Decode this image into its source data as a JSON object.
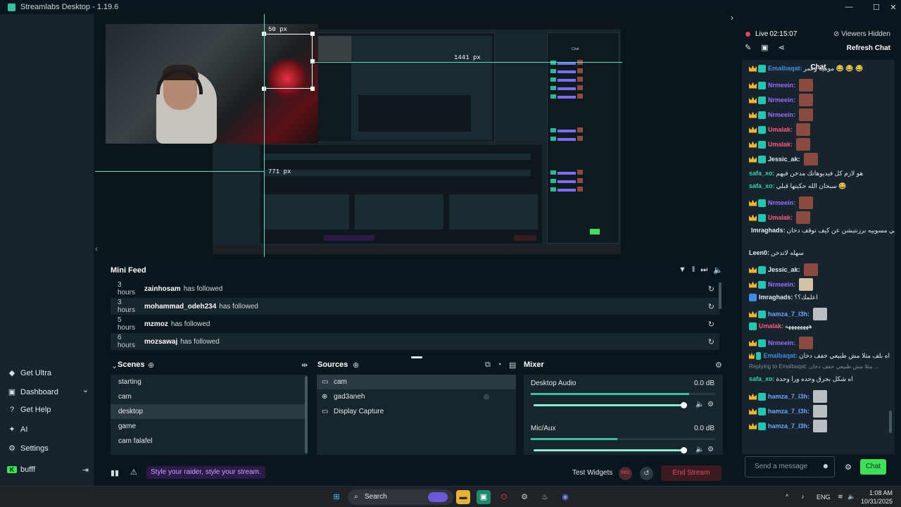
{
  "window": {
    "title": "Streamlabs Desktop - 1.19.6",
    "minimize": "—",
    "maximize": "☐",
    "close": "✕"
  },
  "sidebar": {
    "items": [
      {
        "icon": "diamond-icon",
        "glyph": "◆",
        "label": "Get Ultra"
      },
      {
        "icon": "dashboard-icon",
        "glyph": "▣",
        "label": "Dashboard",
        "chevron": "⌄"
      },
      {
        "icon": "help-icon",
        "glyph": "?",
        "label": "Get Help"
      },
      {
        "icon": "ai-icon",
        "glyph": "✦",
        "label": "AI"
      },
      {
        "icon": "settings-icon",
        "glyph": "⚙",
        "label": "Settings"
      }
    ],
    "user": {
      "name": "bufff",
      "logout": "⇥"
    }
  },
  "preview": {
    "label_top": "50 px",
    "label_right": "1441 px",
    "label_left": "771 px"
  },
  "mini_feed": {
    "title": "Mini Feed",
    "rows": [
      {
        "time": "3 hours",
        "user": "zainhosam",
        "action": "has followed"
      },
      {
        "time": "3 hours",
        "user": "mohammad_odeh234",
        "action": "has followed"
      },
      {
        "time": "5 hours",
        "user": "mzmoz",
        "action": "has followed"
      },
      {
        "time": "6 hours",
        "user": "mozsawaj",
        "action": "has followed"
      }
    ]
  },
  "scenes": {
    "title": "Scenes",
    "items": [
      "starting",
      "cam",
      "desktop",
      "game",
      "cam falafel"
    ],
    "selected": "desktop"
  },
  "sources": {
    "title": "Sources",
    "items": [
      {
        "icon": "camera-icon",
        "glyph": "▭",
        "label": "cam"
      },
      {
        "icon": "globe-icon",
        "glyph": "⊕",
        "label": "gad3aneh"
      },
      {
        "icon": "monitor-icon",
        "glyph": "▭",
        "label": "Display Capture"
      }
    ]
  },
  "mixer": {
    "title": "Mixer",
    "channels": [
      {
        "name": "Desktop Audio",
        "db": "0.0 dB",
        "meter": 0.86,
        "volume": 1.0
      },
      {
        "name": "Mic/Aux",
        "db": "0.0 dB",
        "meter": 0.47,
        "volume": 1.0
      }
    ]
  },
  "bottom": {
    "promo": "Style your raider, style your stream.",
    "test_widgets": "Test Widgets",
    "rec": "REC",
    "end_stream": "End Stream"
  },
  "right": {
    "live_label": "Live",
    "live_time": "02:15:07",
    "viewers": "Viewers Hidden",
    "refresh": "Refresh Chat",
    "chat_title": "Chat",
    "input_placeholder": "Send a message",
    "chat_button": "Chat"
  },
  "chat": [
    {
      "name": "Emalbaqat",
      "color": "#3c8fe0",
      "text": "موميه وغمر 😂 😂 😂",
      "emote": ""
    },
    {
      "name": "Nrmeein",
      "color": "#9b6cff",
      "text": "",
      "emote": "red"
    },
    {
      "name": "Nrmeein",
      "color": "#9b6cff",
      "text": "",
      "emote": "red"
    },
    {
      "name": "Nrmeein",
      "color": "#9b6cff",
      "text": "",
      "emote": "red"
    },
    {
      "name": "Umalak",
      "color": "#ff5a7a",
      "text": "",
      "emote": "red"
    },
    {
      "name": "Umalak",
      "color": "#ff5a7a",
      "text": "",
      "emote": "red"
    },
    {
      "name": "Jessic_ak",
      "color": "#e6ecee",
      "text": "",
      "emote": "red"
    },
    {
      "name": "safa_xo",
      "color": "#2fd3a8",
      "text": "هو لازم كل فيديوهاتك مدخن فيهم",
      "emote": ""
    },
    {
      "name": "safa_xo",
      "color": "#2fd3a8",
      "text": "سبحان الله حكيتها قبلي 😂",
      "emote": ""
    },
    {
      "name": "Nrmeein",
      "color": "#9b6cff",
      "text": "",
      "emote": "red"
    },
    {
      "name": "Umalak",
      "color": "#ff5a7a",
      "text": "",
      "emote": "red"
    },
    {
      "name": "Imraghads",
      "color": "#e6ecee",
      "text": "توني مسوييه برزنتيشن عن كيف توقف دخان",
      "emote": ""
    },
    {
      "name": "Leen0",
      "color": "#e6ecee",
      "text": "سهله لاتدخن",
      "emote": ""
    },
    {
      "name": "Jessic_ak",
      "color": "#e6ecee",
      "text": "",
      "emote": "red"
    },
    {
      "name": "Nrmeein",
      "color": "#9b6cff",
      "text": "",
      "emote": "face"
    },
    {
      "name": "Imraghads",
      "color": "#e6ecee",
      "text": "اعلمك؟؟",
      "emote": ""
    },
    {
      "name": "hamza_7_l3h",
      "color": "#6aa8ff",
      "text": "",
      "emote": "cat"
    },
    {
      "name": "Umalak",
      "color": "#ff5a7a",
      "text": "ههههههههه",
      "emote": ""
    },
    {
      "name": "Nrmeein",
      "color": "#9b6cff",
      "text": "",
      "emote": "red"
    },
    {
      "name": "Emalbaqat",
      "color": "#3c8fe0",
      "text": "اه بلف مثلا مش طبيعي خفف دخان",
      "emote": ""
    },
    {
      "name": "safa_xo",
      "color": "#2fd3a8",
      "text": "اه شكل بحرق وحده ورا وحدة",
      "emote": ""
    },
    {
      "name": "hamza_7_l3h",
      "color": "#6aa8ff",
      "text": "",
      "emote": "cat"
    },
    {
      "name": "hamza_7_l3h",
      "color": "#6aa8ff",
      "text": "",
      "emote": "cat"
    },
    {
      "name": "hamza_7_l3h",
      "color": "#6aa8ff",
      "text": "",
      "emote": "cat"
    }
  ],
  "reply_note": "Replying to Emalbaqat: مثلا مش طبيعي خفف دخان ...",
  "taskbar": {
    "search": "Search",
    "lang": "ENG",
    "time": "1:08 AM",
    "date": "10/31/2025"
  }
}
